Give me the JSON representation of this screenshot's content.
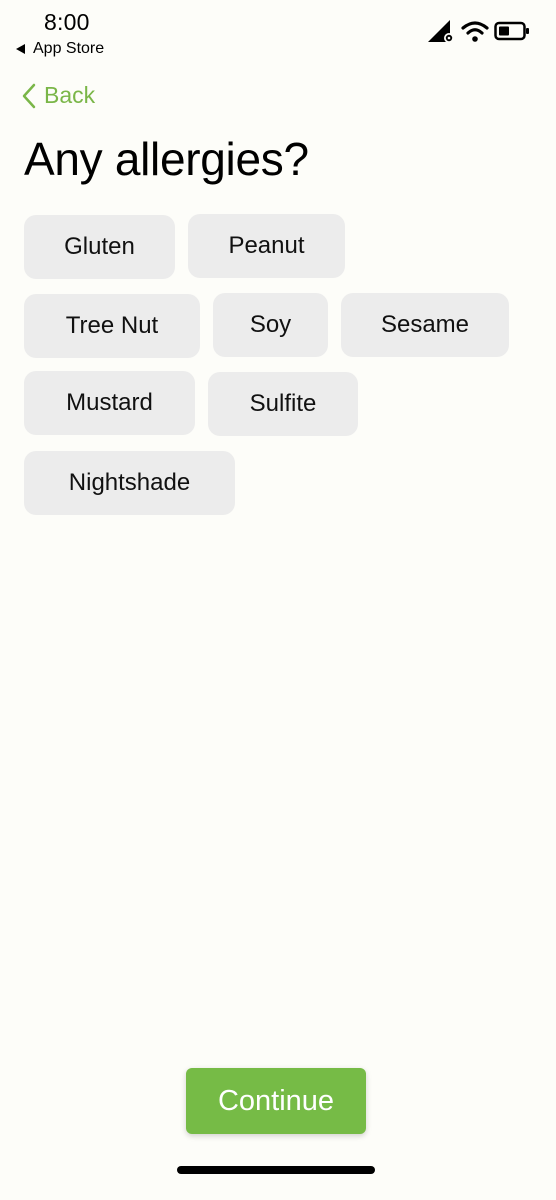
{
  "status_bar": {
    "time": "8:00",
    "back_app": "App Store",
    "icons": [
      "signal-icon",
      "wifi-icon",
      "battery-icon"
    ]
  },
  "nav": {
    "back_label": "Back"
  },
  "title": "Any allergies?",
  "chips": [
    "Gluten",
    "Peanut",
    "Tree Nut",
    "Soy",
    "Sesame",
    "Mustard",
    "Sulfite",
    "Nightshade"
  ],
  "continue_label": "Continue",
  "colors": {
    "accent": "#7ab648",
    "button": "#76bb46",
    "chip_bg": "#ececec",
    "background": "#fdfdf9"
  }
}
